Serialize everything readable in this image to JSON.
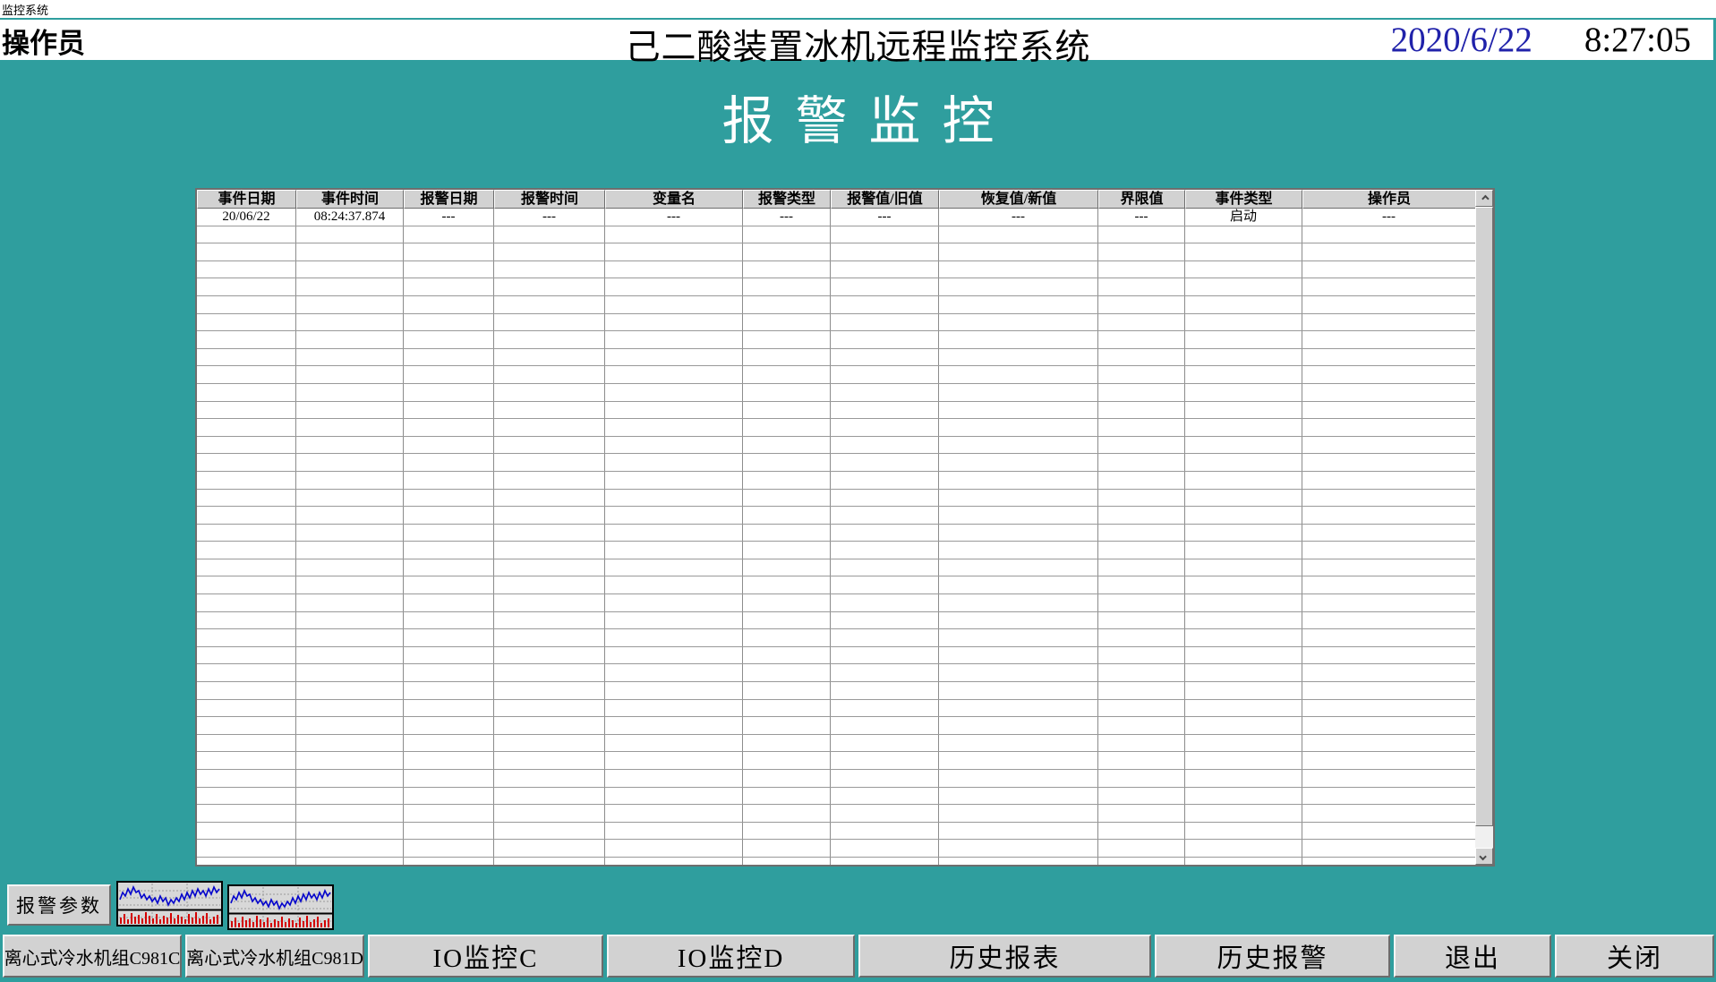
{
  "window": {
    "system_label": "监控系统",
    "operator_label": "操作员",
    "title": "己二酸装置冰机远程监控系统",
    "date": "2020/6/22",
    "time": "8:27:05"
  },
  "page": {
    "heading": "报警监控"
  },
  "alarm_table": {
    "columns": [
      "事件日期",
      "事件时间",
      "报警日期",
      "报警时间",
      "变量名",
      "报警类型",
      "报警值/旧值",
      "恢复值/新值",
      "界限值",
      "事件类型",
      "操作员"
    ],
    "rows": [
      [
        "20/06/22",
        "08:24:37.874",
        "---",
        "---",
        "---",
        "---",
        "---",
        "---",
        "---",
        "启动",
        "---"
      ]
    ],
    "empty_row_count": 38
  },
  "toolbar": {
    "alarm_params_label": "报警参数"
  },
  "nav_buttons": [
    {
      "label": "离心式冷水机组C981C"
    },
    {
      "label": "离心式冷水机组C981D"
    },
    {
      "label": "IO监控C"
    },
    {
      "label": "IO监控D"
    },
    {
      "label": "历史报表"
    },
    {
      "label": "历史报警"
    },
    {
      "label": "退出"
    },
    {
      "label": "关闭"
    }
  ],
  "colors": {
    "teal_background": "#2f9e9e",
    "date_blue": "#2022aa",
    "header_gray": "#d2d2d2",
    "trend_line_blue": "#0000cc",
    "trend_bar_red": "#d40000"
  }
}
